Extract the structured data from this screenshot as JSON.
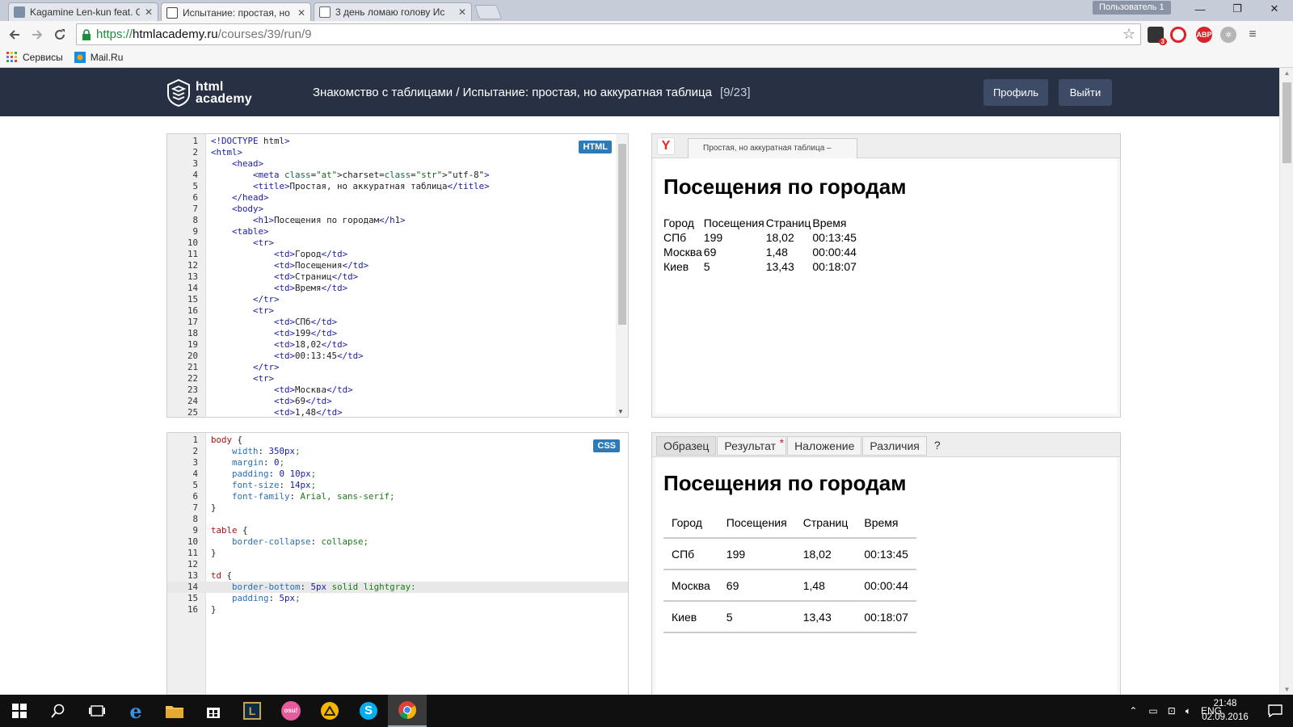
{
  "browser": {
    "tabs": [
      {
        "title": "Kagamine Len-kun feat. G",
        "favicon_color": "#7d8fa6",
        "active": false
      },
      {
        "title": "Испытание: простая, но",
        "favicon_color": "#444444",
        "active": true
      },
      {
        "title": "3 день ломаю голову Ис",
        "favicon_color": "#666666",
        "active": false
      }
    ],
    "user_chip": "Пользователь 1",
    "window_controls": {
      "minimize": "—",
      "maximize": "❐",
      "close": "✕"
    },
    "url": {
      "protocol": "https://",
      "host": "htmlacademy.ru",
      "path": "/courses/39/run/9"
    },
    "bookmarks": [
      {
        "label": "Сервисы",
        "icon": "apps-grid-icon"
      },
      {
        "label": "Mail.Ru",
        "icon": "mailru-icon"
      }
    ],
    "extensions": [
      {
        "name": "ext-badge-icon",
        "badge": "3",
        "color": "#333333"
      },
      {
        "name": "opera-icon",
        "badge": "",
        "color": "#e0202a"
      },
      {
        "name": "adblock-icon",
        "badge": "ABP",
        "color": "#d9232a"
      },
      {
        "name": "extension-gear-icon",
        "badge": "",
        "color": "#b5b5b5"
      }
    ]
  },
  "header": {
    "logo_line1": "html",
    "logo_line2": "academy",
    "breadcrumb": "Знакомство с таблицами / Испытание: простая, но аккуратная таблица",
    "progress": "[9/23]",
    "profile_button": "Профиль",
    "logout_button": "Выйти"
  },
  "html_editor": {
    "badge": "HTML",
    "lines": [
      {
        "n": "1",
        "code": "<!DOCTYPE html>"
      },
      {
        "n": "2",
        "code": "<html>"
      },
      {
        "n": "3",
        "code": "    <head>"
      },
      {
        "n": "4",
        "code": "        <meta charset=\"utf-8\">"
      },
      {
        "n": "5",
        "code": "        <title>Простая, но аккуратная таблица</title>"
      },
      {
        "n": "6",
        "code": "    </head>"
      },
      {
        "n": "7",
        "code": "    <body>"
      },
      {
        "n": "8",
        "code": "        <h1>Посещения по городам</h1>"
      },
      {
        "n": "9",
        "code": "    <table>"
      },
      {
        "n": "10",
        "code": "        <tr>"
      },
      {
        "n": "11",
        "code": "            <td>Город</td>"
      },
      {
        "n": "12",
        "code": "            <td>Посещения</td>"
      },
      {
        "n": "13",
        "code": "            <td>Страниц</td>"
      },
      {
        "n": "14",
        "code": "            <td>Время</td>"
      },
      {
        "n": "15",
        "code": "        </tr>"
      },
      {
        "n": "16",
        "code": "        <tr>"
      },
      {
        "n": "17",
        "code": "            <td>СПб</td>"
      },
      {
        "n": "18",
        "code": "            <td>199</td>"
      },
      {
        "n": "19",
        "code": "            <td>18,02</td>"
      },
      {
        "n": "20",
        "code": "            <td>00:13:45</td>"
      },
      {
        "n": "21",
        "code": "        </tr>"
      },
      {
        "n": "22",
        "code": "        <tr>"
      },
      {
        "n": "23",
        "code": "            <td>Москва</td>"
      },
      {
        "n": "24",
        "code": "            <td>69</td>"
      },
      {
        "n": "25",
        "code": "            <td>1,48</td>"
      }
    ]
  },
  "css_editor": {
    "badge": "CSS",
    "highlighted_line": "14",
    "lines": [
      {
        "n": "1",
        "code": "body {"
      },
      {
        "n": "2",
        "code": "    width: 350px;"
      },
      {
        "n": "3",
        "code": "    margin: 0;"
      },
      {
        "n": "4",
        "code": "    padding: 0 10px;"
      },
      {
        "n": "5",
        "code": "    font-size: 14px;"
      },
      {
        "n": "6",
        "code": "    font-family: Arial, sans-serif;"
      },
      {
        "n": "7",
        "code": "}"
      },
      {
        "n": "8",
        "code": ""
      },
      {
        "n": "9",
        "code": "table {"
      },
      {
        "n": "10",
        "code": "    border-collapse: collapse;"
      },
      {
        "n": "11",
        "code": "}"
      },
      {
        "n": "12",
        "code": ""
      },
      {
        "n": "13",
        "code": "td {"
      },
      {
        "n": "14",
        "code": "    border-bottom: 5px solid lightgray:"
      },
      {
        "n": "15",
        "code": "    padding: 5px;"
      },
      {
        "n": "16",
        "code": "}"
      }
    ]
  },
  "preview": {
    "yandex_icon": "Y",
    "tab_title": "Простая, но аккуратная таблица –",
    "heading": "Посещения по городам",
    "rows": [
      [
        "Город",
        "Посещения",
        "Страниц",
        "Время"
      ],
      [
        "СПб",
        "199",
        "18,02",
        "00:13:45"
      ],
      [
        "Москва",
        "69",
        "1,48",
        "00:00:44"
      ],
      [
        "Киев",
        "5",
        "13,43",
        "00:18:07"
      ]
    ]
  },
  "sample": {
    "tabs": [
      "Образец",
      "Результат",
      "Наложение",
      "Различия",
      "?"
    ],
    "result_marker": "*",
    "heading": "Посещения по городам",
    "rows": [
      [
        "Город",
        "Посещения",
        "Страниц",
        "Время"
      ],
      [
        "СПб",
        "199",
        "18,02",
        "00:13:45"
      ],
      [
        "Москва",
        "69",
        "1,48",
        "00:00:44"
      ],
      [
        "Киев",
        "5",
        "13,43",
        "00:18:07"
      ]
    ]
  },
  "taskbar": {
    "apps": [
      "windows-start-icon",
      "search-icon",
      "task-view-icon",
      "edge-icon",
      "file-explorer-icon",
      "store-icon",
      "app-l-icon",
      "osu-icon",
      "app-triangle-icon",
      "skype-icon",
      "chrome-icon"
    ],
    "language": "ENG",
    "time": "21:48",
    "date": "02.09.2016"
  }
}
